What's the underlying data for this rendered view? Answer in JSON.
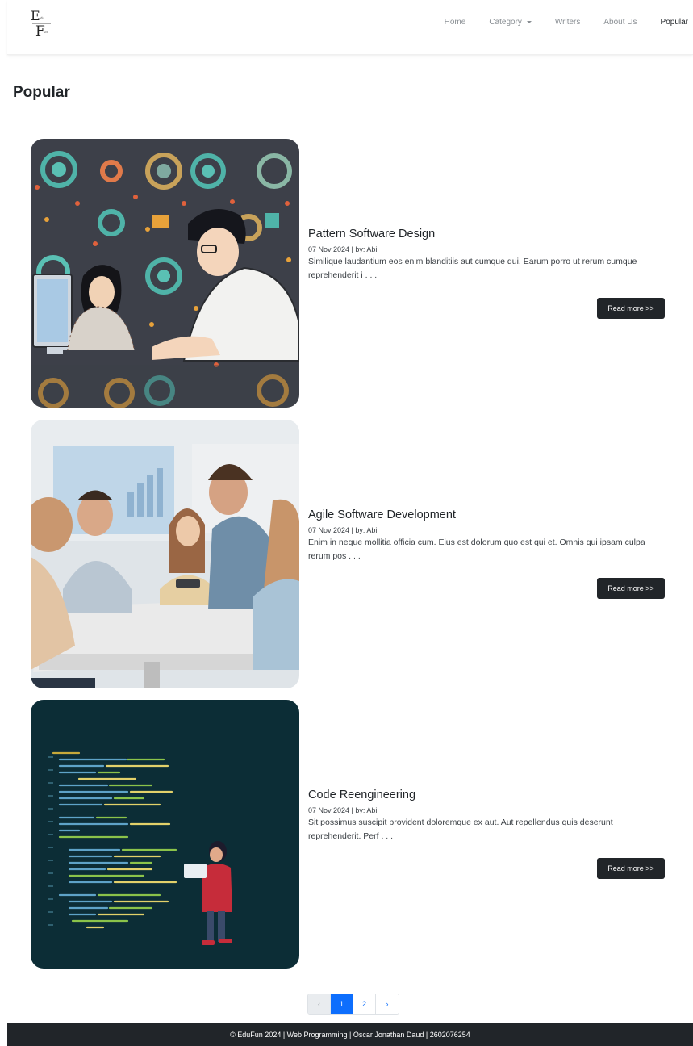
{
  "brand": {
    "logo_text": "EduFun"
  },
  "nav": {
    "items": [
      {
        "label": "Home"
      },
      {
        "label": "Category"
      },
      {
        "label": "Writers"
      },
      {
        "label": "About Us"
      },
      {
        "label": "Popular"
      }
    ]
  },
  "page": {
    "title": "Popular"
  },
  "posts": [
    {
      "title": "Pattern Software Design",
      "meta": "07 Nov 2024 | by: Abi",
      "excerpt": "Similique laudantium eos enim blanditiis aut cumque qui. Earum porro ut rerum cumque reprehenderit i . . .",
      "button": "Read more >>"
    },
    {
      "title": "Agile Software Development",
      "meta": "07 Nov 2024 | by: Abi",
      "excerpt": "Enim in neque mollitia officia cum. Eius est dolorum quo est qui et. Omnis qui ipsam culpa rerum pos . . .",
      "button": "Read more >>"
    },
    {
      "title": "Code Reengineering",
      "meta": "07 Nov 2024 | by: Abi",
      "excerpt": "Sit possimus suscipit provident doloremque ex aut. Aut repellendus quis deserunt reprehenderit. Perf . . .",
      "button": "Read more >>"
    }
  ],
  "pagination": {
    "prev": "‹",
    "pages": [
      "1",
      "2"
    ],
    "next": "›",
    "current": "1"
  },
  "footer": {
    "text": "© EduFun 2024 | Web Programming | Oscar Jonathan Daud | 2602076254"
  }
}
